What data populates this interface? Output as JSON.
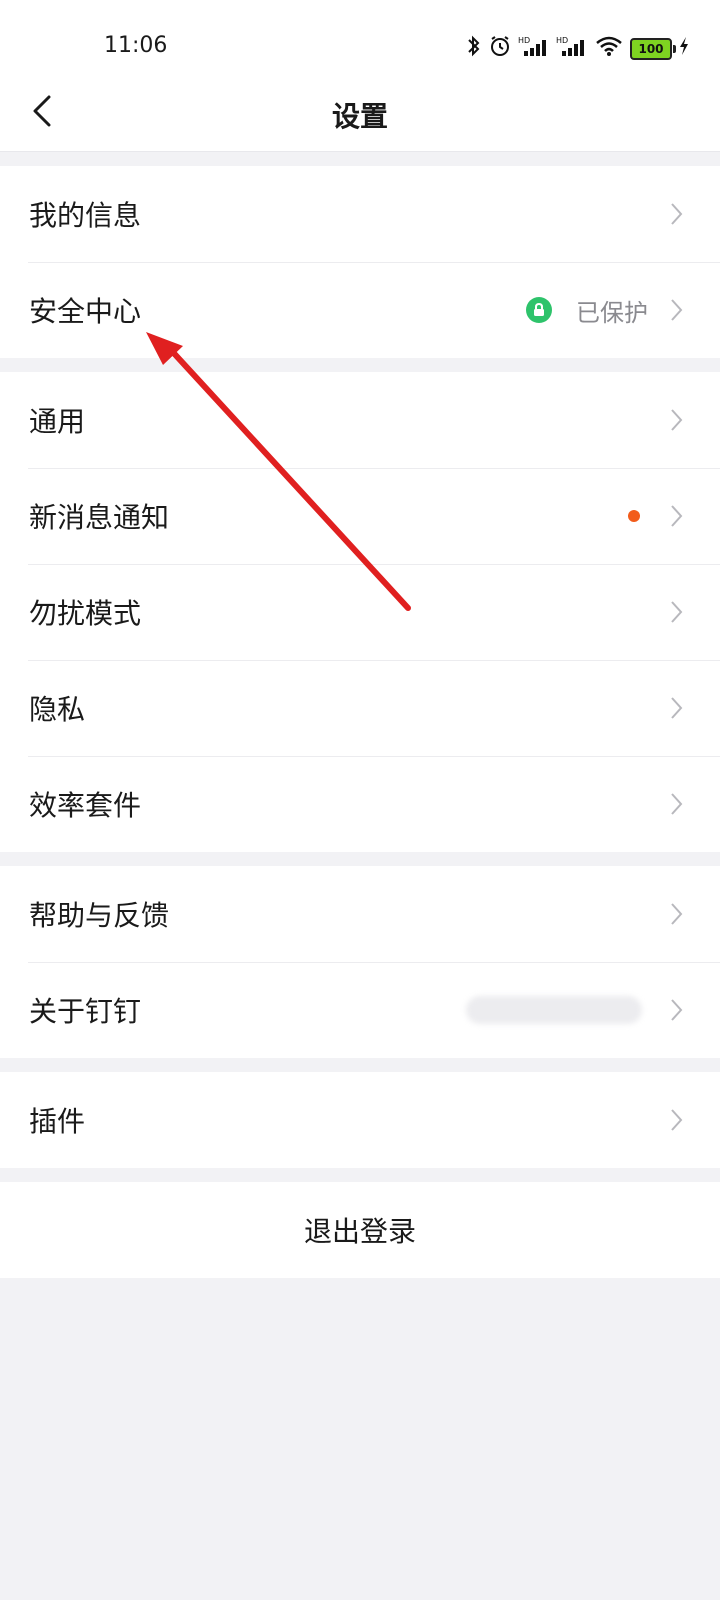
{
  "status_bar": {
    "time": "11:06",
    "battery": "100"
  },
  "header": {
    "title": "设置"
  },
  "groups": [
    {
      "items": [
        {
          "label": "我的信息"
        },
        {
          "label": "安全中心",
          "status": "已保护"
        }
      ]
    },
    {
      "items": [
        {
          "label": "通用"
        },
        {
          "label": "新消息通知"
        },
        {
          "label": "勿扰模式"
        },
        {
          "label": "隐私"
        },
        {
          "label": "效率套件"
        }
      ]
    },
    {
      "items": [
        {
          "label": "帮助与反馈"
        },
        {
          "label": "关于钉钉"
        }
      ]
    },
    {
      "items": [
        {
          "label": "插件"
        }
      ]
    }
  ],
  "logout": {
    "label": "退出登录"
  },
  "colors": {
    "accent_green": "#2ec36b",
    "notification_dot": "#f25c1b",
    "annotation_arrow": "#e02020"
  }
}
